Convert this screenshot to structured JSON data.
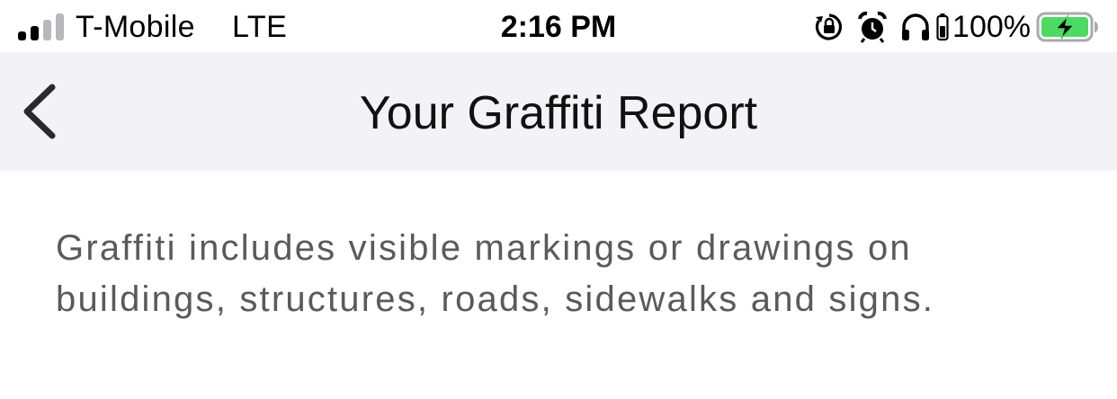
{
  "status_bar": {
    "carrier": "T-Mobile",
    "network": "LTE",
    "time": "2:16 PM",
    "battery_percent": "100%",
    "icons": [
      "signal-icon",
      "orientation-lock-icon",
      "alarm-icon",
      "headphones-icon",
      "battery-icon"
    ],
    "battery_color": "#4cd964"
  },
  "nav": {
    "title": "Your Graffiti Report",
    "back_icon": "chevron-left-icon"
  },
  "content": {
    "description": "Graffiti includes visible markings or drawings on buildings, structures, roads, sidewalks and signs."
  }
}
